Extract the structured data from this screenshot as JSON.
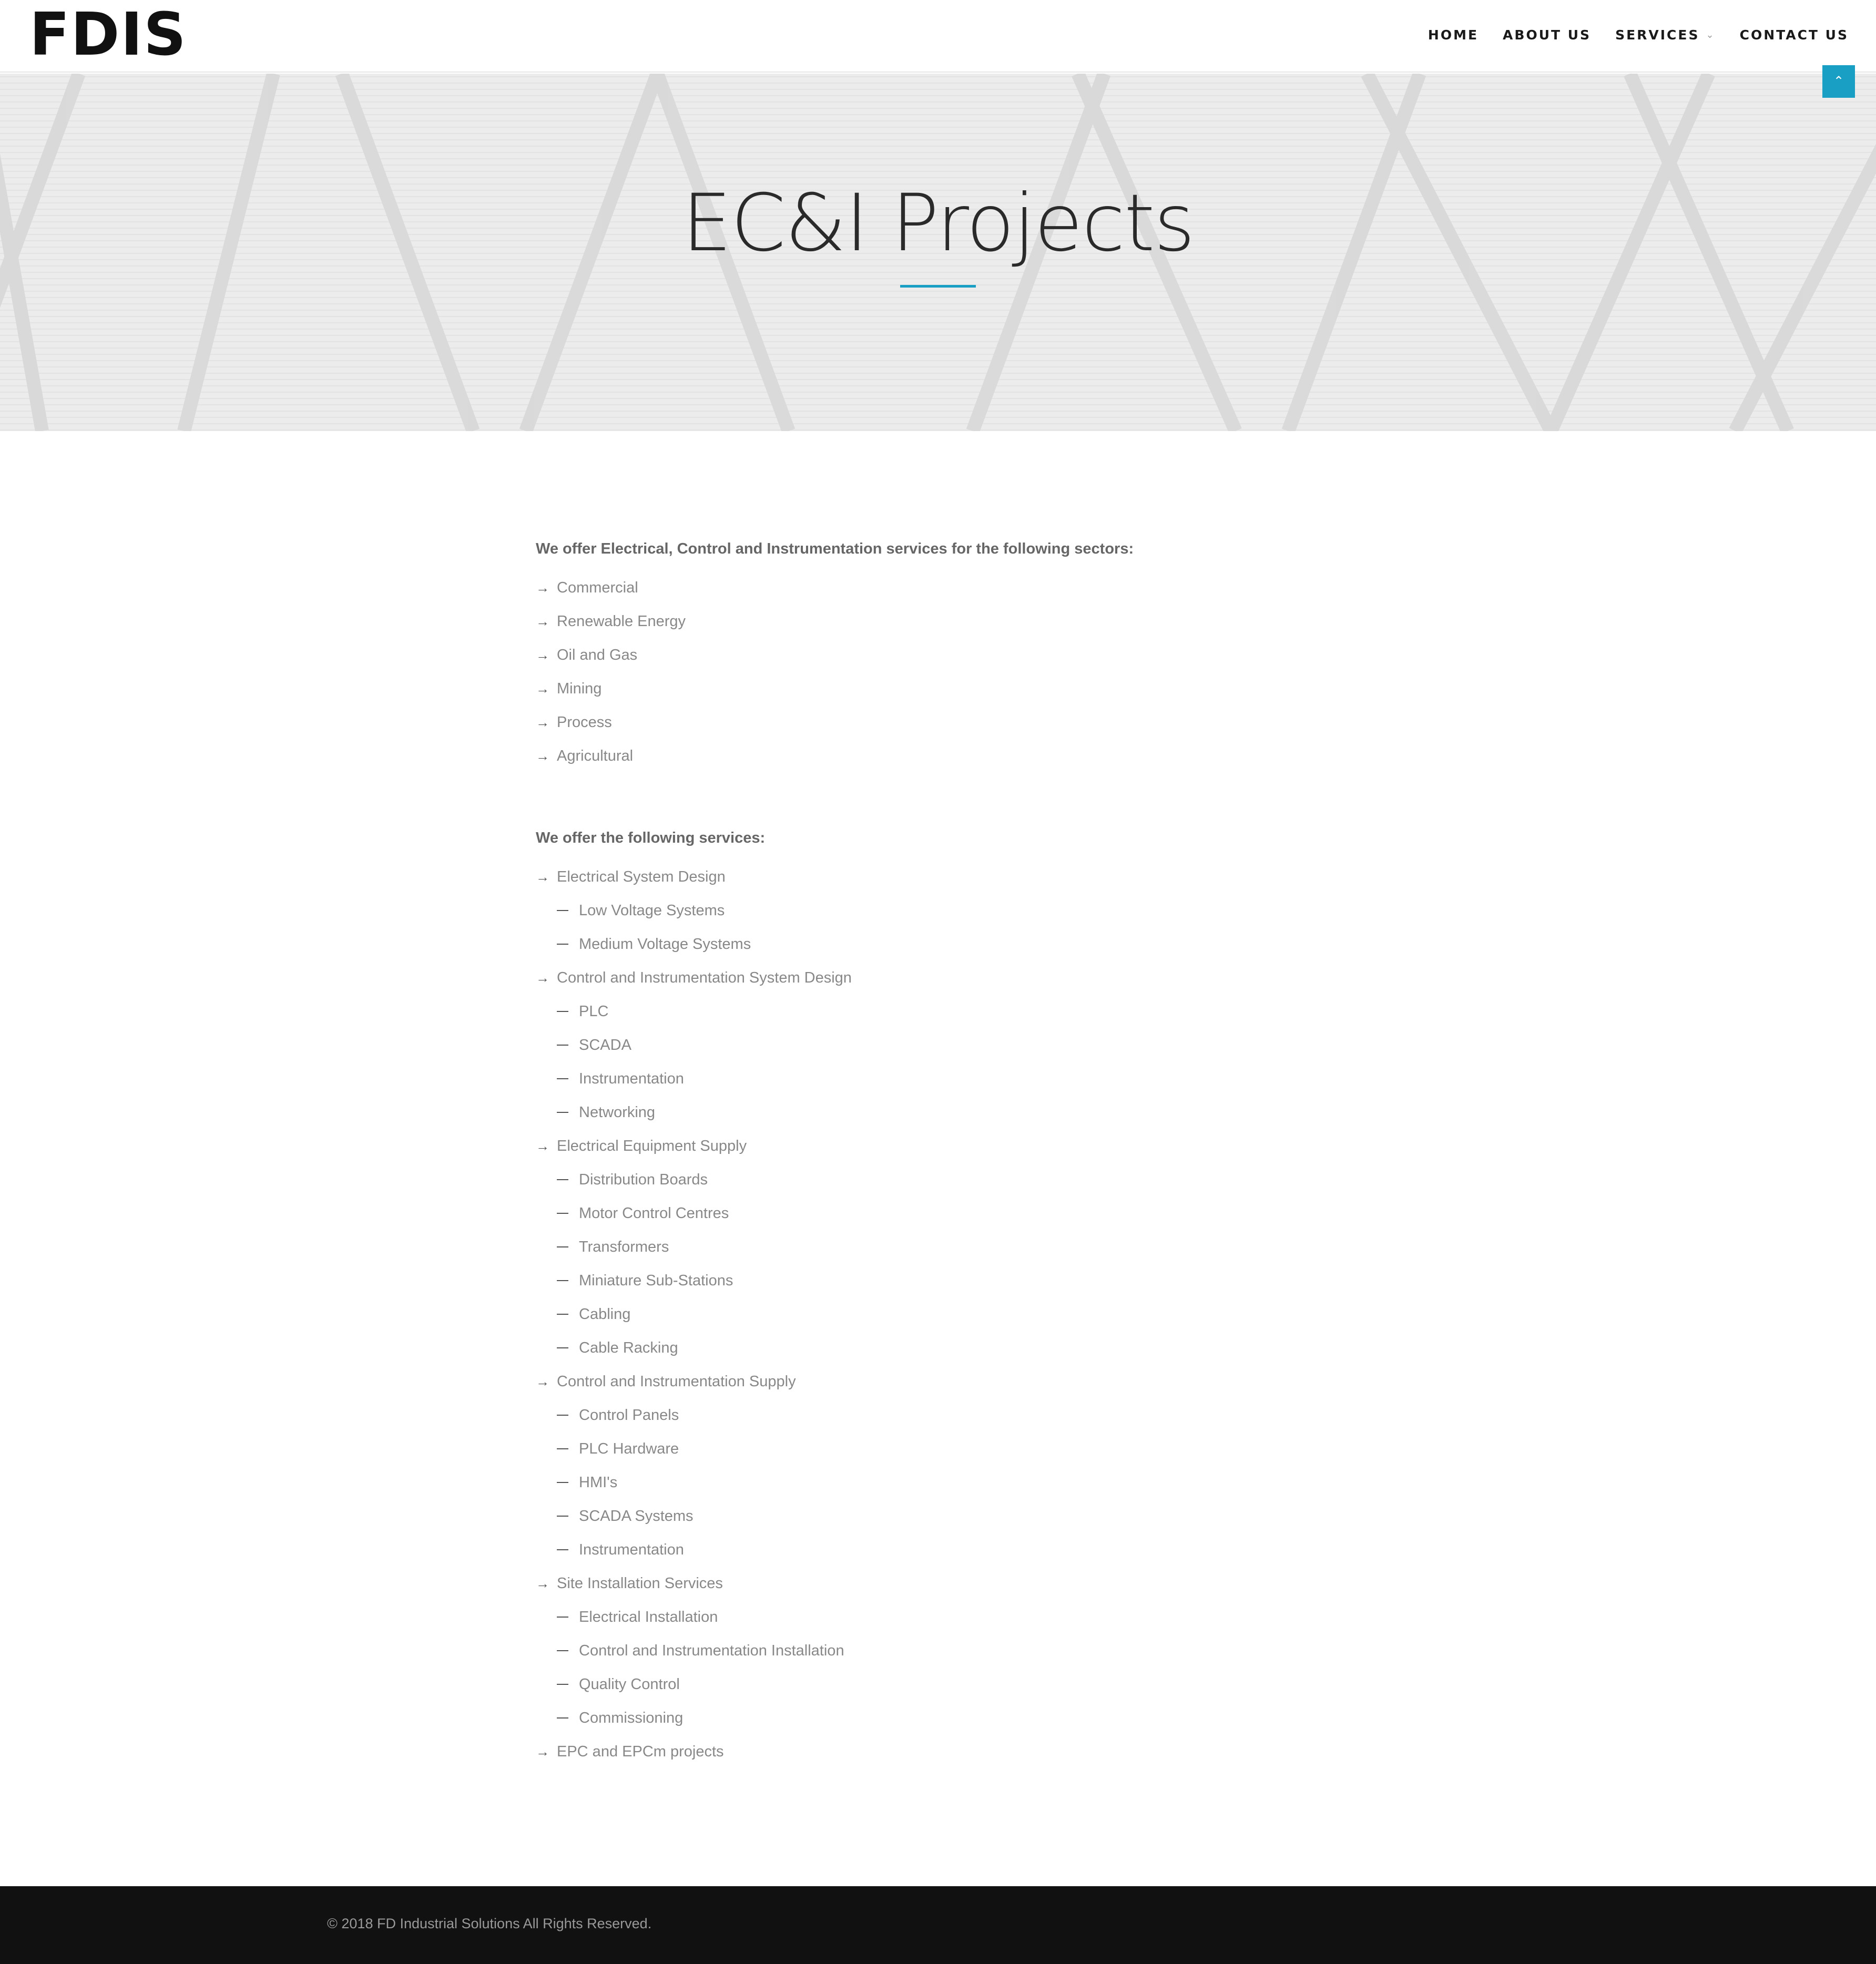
{
  "brand": {
    "logo": "FDIS"
  },
  "nav": {
    "items": [
      {
        "label": "HOME"
      },
      {
        "label": "ABOUT US"
      },
      {
        "label": "SERVICES",
        "has_dropdown": true,
        "icon": "chevron-down-icon"
      },
      {
        "label": "CONTACT US"
      }
    ]
  },
  "hero": {
    "title": "EC&I Projects",
    "accent_color": "#1a9fc4"
  },
  "sectors": {
    "intro": "We offer Electrical, Control and Instrumentation services for the following sectors:",
    "items": [
      "Commercial",
      "Renewable Energy",
      "Oil and Gas",
      "Mining",
      "Process",
      "Agricultural"
    ]
  },
  "services": {
    "intro": "We offer the following services:",
    "groups": [
      {
        "label": "Electrical System Design",
        "sub": [
          "Low Voltage Systems",
          "Medium Voltage Systems"
        ]
      },
      {
        "label": "Control and Instrumentation System Design",
        "sub": [
          "PLC",
          "SCADA",
          "Instrumentation",
          "Networking"
        ]
      },
      {
        "label": "Electrical Equipment Supply",
        "sub": [
          "Distribution Boards",
          "Motor Control Centres",
          "Transformers",
          "Miniature Sub-Stations",
          "Cabling",
          "Cable Racking"
        ]
      },
      {
        "label": "Control and Instrumentation Supply",
        "sub": [
          "Control Panels",
          "PLC Hardware",
          "HMI's",
          "SCADA Systems",
          "Instrumentation"
        ]
      },
      {
        "label": "Site Installation Services",
        "sub": [
          "Electrical Installation",
          "Control and Instrumentation Installation",
          "Quality Control",
          "Commissioning"
        ]
      },
      {
        "label": "EPC and EPCm projects",
        "sub": []
      }
    ]
  },
  "footer": {
    "copyright": "© 2018 FD Industrial Solutions All Rights Reserved.",
    "back_to_top_icon": "chevron-up-icon"
  }
}
